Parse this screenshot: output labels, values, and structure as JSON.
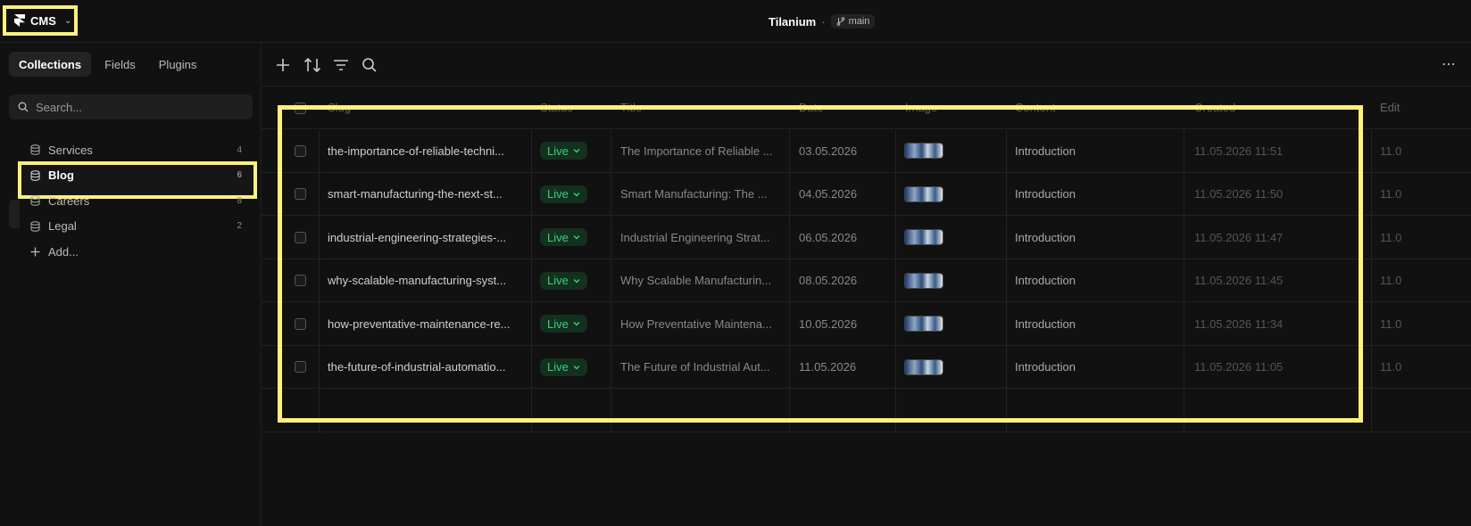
{
  "topbar": {
    "cms_label": "CMS",
    "project_name": "Tilanium",
    "separator": "·",
    "branch": "main"
  },
  "sidebar": {
    "tabs": [
      {
        "label": "Collections",
        "active": true
      },
      {
        "label": "Fields",
        "active": false
      },
      {
        "label": "Plugins",
        "active": false
      }
    ],
    "search_placeholder": "Search...",
    "collections": [
      {
        "label": "Services",
        "count": "4"
      },
      {
        "label": "Blog",
        "count": "6"
      },
      {
        "label": "Careers",
        "count": "8"
      },
      {
        "label": "Legal",
        "count": "2"
      }
    ],
    "add_label": "Add..."
  },
  "table": {
    "headers": {
      "slug": "Slug",
      "status": "Status",
      "title": "Title",
      "date": "Date",
      "image": "Image",
      "content": "Content",
      "created": "Created",
      "edited": "Edit"
    },
    "rows": [
      {
        "slug": "the-importance-of-reliable-techni...",
        "status": "Live",
        "title": "The Importance of Reliable ...",
        "date": "03.05.2026",
        "content": "Introduction",
        "created": "11.05.2026 11:51",
        "edge": "11.0"
      },
      {
        "slug": "smart-manufacturing-the-next-st...",
        "status": "Live",
        "title": "Smart Manufacturing: The ...",
        "date": "04.05.2026",
        "content": "Introduction",
        "created": "11.05.2026 11:50",
        "edge": "11.0"
      },
      {
        "slug": "industrial-engineering-strategies-...",
        "status": "Live",
        "title": "Industrial Engineering Strat...",
        "date": "06.05.2026",
        "content": "Introduction",
        "created": "11.05.2026 11:47",
        "edge": "11.0"
      },
      {
        "slug": "why-scalable-manufacturing-syst...",
        "status": "Live",
        "title": "Why Scalable Manufacturin...",
        "date": "08.05.2026",
        "content": "Introduction",
        "created": "11.05.2026 11:45",
        "edge": "11.0"
      },
      {
        "slug": "how-preventative-maintenance-re...",
        "status": "Live",
        "title": "How Preventative Maintena...",
        "date": "10.05.2026",
        "content": "Introduction",
        "created": "11.05.2026 11:34",
        "edge": "11.0"
      },
      {
        "slug": "the-future-of-industrial-automatio...",
        "status": "Live",
        "title": "The Future of Industrial Aut...",
        "date": "11.05.2026",
        "content": "Introduction",
        "created": "11.05.2026 11:05",
        "edge": "11.0"
      }
    ]
  },
  "colors": {
    "highlight": "#fff17a",
    "status_live": "#37d37a",
    "background": "#111111"
  },
  "icons": {
    "logo": "framer-logo-icon",
    "branch": "git-branch-icon",
    "search": "search-icon",
    "collection": "database-icon",
    "add": "plus-icon",
    "sort": "sort-arrows-icon",
    "filter": "filter-lines-icon",
    "more": "more-dots-icon"
  }
}
